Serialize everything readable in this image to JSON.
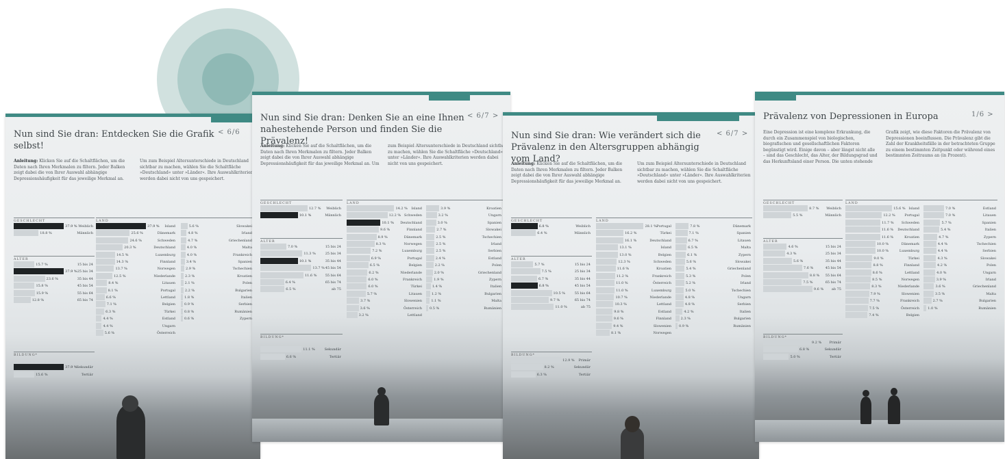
{
  "colors": {
    "accent": "#3f8a84",
    "bar": "#cfd4d7",
    "bar_selected": "#1e2224",
    "text": "#2f3437"
  },
  "instruction": {
    "label": "Anleitung:",
    "body": "Klicken Sie auf die Schaltflächen, um die Daten nach Ihren Merkmalen zu filtern. Jeder Balken zeigt dabei die von Ihrer Auswahl abhängige Depressionshäufigkeit für das jeweilige Merkmal an. Um zum Beispiel Altersunterschiede in Deutschland sichtbar zu machen, wählen Sie die Schaltfläche »Deutschland« unter »Länder«. Ihre Auswahlkriterien werden dabei nicht von uns gespeichert."
  },
  "sections": {
    "gender": "GESCHLECHT",
    "country": "LAND",
    "age": "ALTER",
    "education": "BILDUNG*"
  },
  "cards": [
    {
      "title": "Nun sind Sie dran: Entdecken Sie die Grafik selbst!",
      "nav": "< 6/6",
      "gender": [
        {
          "pct": "37.9 %",
          "label": "Weiblich"
        },
        {
          "pct": "18.8 %",
          "label": "Männlich"
        }
      ],
      "age": [
        {
          "pct": "15.7 %",
          "label": "15 bis 24"
        },
        {
          "pct": "37.9 %",
          "label": "25 bis 34"
        },
        {
          "pct": "23.6 %",
          "label": "35 bis 44"
        },
        {
          "pct": "15.8 %",
          "label": "45 bis 54"
        },
        {
          "pct": "15.9 %",
          "label": "55 bis 64"
        },
        {
          "pct": "12.8 %",
          "label": "65 bis 74"
        }
      ],
      "education": [
        {
          "pct": "37.9 %",
          "label": "Sekundär"
        },
        {
          "pct": "15.6 %",
          "label": "Tertiär"
        }
      ],
      "country1": [
        {
          "pct": "37.9 %",
          "label": "Island"
        },
        {
          "pct": "25.6 %",
          "label": "Dänemark"
        },
        {
          "pct": "24.6 %",
          "label": "Schweden"
        },
        {
          "pct": "20.3 %",
          "label": "Deutschland"
        },
        {
          "pct": "14.5 %",
          "label": "Luxemburg"
        },
        {
          "pct": "14.3 %",
          "label": "Finnland"
        },
        {
          "pct": "13.7 %",
          "label": "Norwegen"
        },
        {
          "pct": "12.5 %",
          "label": "Niederlande"
        },
        {
          "pct": "8.4 %",
          "label": "Litauen"
        },
        {
          "pct": "8.1 %",
          "label": "Portugal"
        },
        {
          "pct": "6.6 %",
          "label": "Lettland"
        },
        {
          "pct": "7.1 %",
          "label": "Belgien"
        },
        {
          "pct": "6.3 %",
          "label": "Türkei"
        },
        {
          "pct": "4.4 %",
          "label": "Estland"
        },
        {
          "pct": "4.4 %",
          "label": "Ungarn"
        },
        {
          "pct": "5.6 %",
          "label": "Österreich"
        }
      ],
      "country2": [
        {
          "pct": "5.6 %",
          "label": "Slowakei"
        },
        {
          "pct": "4.8 %",
          "label": "Irland"
        },
        {
          "pct": "4.7 %",
          "label": "Griechenland"
        },
        {
          "pct": "4.0 %",
          "label": "Malta"
        },
        {
          "pct": "4.0 %",
          "label": "Frankreich"
        },
        {
          "pct": "3.4 %",
          "label": "Spanien"
        },
        {
          "pct": "2.9 %",
          "label": "Tschechien"
        },
        {
          "pct": "2.3 %",
          "label": "Kroatien"
        },
        {
          "pct": "2.1 %",
          "label": "Polen"
        },
        {
          "pct": "2.2 %",
          "label": "Bulgarien"
        },
        {
          "pct": "1.8 %",
          "label": "Italien"
        },
        {
          "pct": "0.9 %",
          "label": "Serbien"
        },
        {
          "pct": "0.8 %",
          "label": "Rumänien"
        },
        {
          "pct": "0.6 %",
          "label": "Zypern"
        }
      ]
    },
    {
      "title": "Nun sind Sie dran: Denken Sie an eine Ihnen nahestehende Person und finden Sie die Prävalenz!",
      "nav": "< 6/7 >",
      "gender": [
        {
          "pct": "12.7 %",
          "label": "Weiblich"
        },
        {
          "pct": "10.1 %",
          "label": "Männlich"
        }
      ],
      "age": [
        {
          "pct": "7.0 %",
          "label": "15 bis 24"
        },
        {
          "pct": "11.3 %",
          "label": "25 bis 34"
        },
        {
          "pct": "10.1 %",
          "label": "35 bis 44"
        },
        {
          "pct": "13.7 %",
          "label": "45 bis 54"
        },
        {
          "pct": "11.6 %",
          "label": "55 bis 64"
        },
        {
          "pct": "6.4 %",
          "label": "65 bis 74"
        },
        {
          "pct": "6.5 %",
          "label": "ab 75"
        }
      ],
      "education": [
        {
          "pct": "11.1 %",
          "label": "Sekundär"
        },
        {
          "pct": "6.6 %",
          "label": "Tertiär"
        }
      ],
      "country1": [
        {
          "pct": "14.2 %",
          "label": "Island"
        },
        {
          "pct": "12.2 %",
          "label": "Schweden"
        },
        {
          "pct": "10.1 %",
          "label": "Deutschland"
        },
        {
          "pct": "9.6 %",
          "label": "Finnland"
        },
        {
          "pct": "8.9 %",
          "label": "Dänemark"
        },
        {
          "pct": "8.3 %",
          "label": "Norwegen"
        },
        {
          "pct": "7.2 %",
          "label": "Luxemburg"
        },
        {
          "pct": "6.9 %",
          "label": "Portugal"
        },
        {
          "pct": "6.5 %",
          "label": "Belgien"
        },
        {
          "pct": "6.2 %",
          "label": "Niederlande"
        },
        {
          "pct": "6.0 %",
          "label": "Frankreich"
        },
        {
          "pct": "6.0 %",
          "label": "Türkei"
        },
        {
          "pct": "5.7 %",
          "label": "Litauen"
        },
        {
          "pct": "3.7 %",
          "label": "Slowenien"
        },
        {
          "pct": "3.6 %",
          "label": "Österreich"
        },
        {
          "pct": "3.2 %",
          "label": "Lettland"
        }
      ],
      "country2": [
        {
          "pct": "3.9 %",
          "label": "Kroatien"
        },
        {
          "pct": "3.2 %",
          "label": "Ungarn"
        },
        {
          "pct": "3.0 %",
          "label": "Spanien"
        },
        {
          "pct": "2.7 %",
          "label": "Slowakei"
        },
        {
          "pct": "2.5 %",
          "label": "Tschechien"
        },
        {
          "pct": "2.5 %",
          "label": "Irland"
        },
        {
          "pct": "2.5 %",
          "label": "Serbien"
        },
        {
          "pct": "2.4 %",
          "label": "Estland"
        },
        {
          "pct": "2.2 %",
          "label": "Polen"
        },
        {
          "pct": "2.0 %",
          "label": "Griechenland"
        },
        {
          "pct": "1.9 %",
          "label": "Zypern"
        },
        {
          "pct": "1.4 %",
          "label": "Italien"
        },
        {
          "pct": "1.2 %",
          "label": "Bulgarien"
        },
        {
          "pct": "1.1 %",
          "label": "Malta"
        },
        {
          "pct": "0.5 %",
          "label": "Rumänien"
        }
      ]
    },
    {
      "title": "Nun sind Sie dran: Wie verändert sich die Prävalenz in den Altersgruppen abhängig vom Land?",
      "nav": "< 6/7 >",
      "gender": [
        {
          "pct": "6.8 %",
          "label": "Weiblich"
        },
        {
          "pct": "6.4 %",
          "label": "Männlich"
        }
      ],
      "age": [
        {
          "pct": "5.7 %",
          "label": "15 bis 24"
        },
        {
          "pct": "7.5 %",
          "label": "25 bis 34"
        },
        {
          "pct": "6.7 %",
          "label": "35 bis 44"
        },
        {
          "pct": "6.8 %",
          "label": "45 bis 54"
        },
        {
          "pct": "10.5 %",
          "label": "55 bis 64"
        },
        {
          "pct": "9.7 %",
          "label": "65 bis 74"
        },
        {
          "pct": "11.0 %",
          "label": "ab 75"
        }
      ],
      "education": [
        {
          "pct": "12.9 %",
          "label": "Primär"
        },
        {
          "pct": "8.2 %",
          "label": "Sekundär"
        },
        {
          "pct": "6.3 %",
          "label": "Tertiär"
        }
      ],
      "country1": [
        {
          "pct": "28.1 %",
          "label": "Portugal"
        },
        {
          "pct": "16.2 %",
          "label": "Türkei"
        },
        {
          "pct": "16.1 %",
          "label": "Deutschland"
        },
        {
          "pct": "13.1 %",
          "label": "Island"
        },
        {
          "pct": "13.0 %",
          "label": "Belgien"
        },
        {
          "pct": "12.3 %",
          "label": "Schweden"
        },
        {
          "pct": "11.6 %",
          "label": "Kroatien"
        },
        {
          "pct": "11.2 %",
          "label": "Frankreich"
        },
        {
          "pct": "11.0 %",
          "label": "Österreich"
        },
        {
          "pct": "11.0 %",
          "label": "Luxemburg"
        },
        {
          "pct": "10.7 %",
          "label": "Niederlande"
        },
        {
          "pct": "10.3 %",
          "label": "Lettland"
        },
        {
          "pct": "9.8 %",
          "label": "Estland"
        },
        {
          "pct": "9.6 %",
          "label": "Finnland"
        },
        {
          "pct": "9.4 %",
          "label": "Slowenien"
        },
        {
          "pct": "8.1 %",
          "label": "Norwegen"
        }
      ],
      "country2": [
        {
          "pct": "7.8 %",
          "label": "Dänemark"
        },
        {
          "pct": "7.1 %",
          "label": "Spanien"
        },
        {
          "pct": "6.7 %",
          "label": "Litauen"
        },
        {
          "pct": "6.5 %",
          "label": "Malta"
        },
        {
          "pct": "6.1 %",
          "label": "Zypern"
        },
        {
          "pct": "5.6 %",
          "label": "Slowakei"
        },
        {
          "pct": "5.4 %",
          "label": "Griechenland"
        },
        {
          "pct": "5.3 %",
          "label": "Polen"
        },
        {
          "pct": "5.2 %",
          "label": "Irland"
        },
        {
          "pct": "5.0 %",
          "label": "Tschechien"
        },
        {
          "pct": "4.8 %",
          "label": "Ungarn"
        },
        {
          "pct": "4.8 %",
          "label": "Serbien"
        },
        {
          "pct": "4.2 %",
          "label": "Italien"
        },
        {
          "pct": "2.3 %",
          "label": "Bulgarien"
        },
        {
          "pct": "0.9 %",
          "label": "Rumänien"
        }
      ]
    },
    {
      "title": "Prävalenz von Depressionen in Europa",
      "nav": "1/6 >",
      "intro": "Eine Depression ist eine komplexe Erkrankung, die durch ein Zusammenspiel von biologischen, biografischen und gesellschaftlichen Faktoren begünstigt wird. Einige davon – aber längst nicht alle – sind das Geschlecht, das Alter, der Bildungsgrad und das Herkunftsland einer Person. Die unten stehende Grafik zeigt, wie diese Faktoren die Prävalenz von Depressionen beeinflussen. Die Prävalenz gibt die Zahl der Krankheitsfälle in der betrachteten Gruppe zu einem bestimmten Zeitpunkt oder während eines bestimmten Zeitraums an (in Prozent).",
      "gender": [
        {
          "pct": "8.7 %",
          "label": "Weiblich"
        },
        {
          "pct": "5.5 %",
          "label": "Männlich"
        }
      ],
      "age": [
        {
          "pct": "4.6 %",
          "label": "15 bis 24"
        },
        {
          "pct": "4.3 %",
          "label": "25 bis 34"
        },
        {
          "pct": "5.6 %",
          "label": "35 bis 44"
        },
        {
          "pct": "7.6 %",
          "label": "45 bis 54"
        },
        {
          "pct": "8.8 %",
          "label": "55 bis 64"
        },
        {
          "pct": "7.5 %",
          "label": "65 bis 74"
        },
        {
          "pct": "9.6 %",
          "label": "ab 75"
        }
      ],
      "education": [
        {
          "pct": "9.2 %",
          "label": "Primär"
        },
        {
          "pct": "6.8 %",
          "label": "Sekundär"
        },
        {
          "pct": "5.0 %",
          "label": "Tertiär"
        }
      ],
      "country1": [
        {
          "pct": "15.6 %",
          "label": "Island"
        },
        {
          "pct": "12.2 %",
          "label": "Portugal"
        },
        {
          "pct": "11.7 %",
          "label": "Schweden"
        },
        {
          "pct": "11.6 %",
          "label": "Deutschland"
        },
        {
          "pct": "11.6 %",
          "label": "Kroatien"
        },
        {
          "pct": "10.0 %",
          "label": "Dänemark"
        },
        {
          "pct": "10.0 %",
          "label": "Luxemburg"
        },
        {
          "pct": "9.0 %",
          "label": "Türkei"
        },
        {
          "pct": "8.8 %",
          "label": "Finnland"
        },
        {
          "pct": "8.6 %",
          "label": "Lettland"
        },
        {
          "pct": "8.5 %",
          "label": "Norwegen"
        },
        {
          "pct": "8.3 %",
          "label": "Niederlande"
        },
        {
          "pct": "7.9 %",
          "label": "Slowenien"
        },
        {
          "pct": "7.7 %",
          "label": "Frankreich"
        },
        {
          "pct": "7.5 %",
          "label": "Österreich"
        },
        {
          "pct": "7.4 %",
          "label": "Belgien"
        }
      ],
      "country2": [
        {
          "pct": "7.0 %",
          "label": "Estland"
        },
        {
          "pct": "7.0 %",
          "label": "Litauen"
        },
        {
          "pct": "5.7 %",
          "label": "Spanien"
        },
        {
          "pct": "5.4 %",
          "label": "Italien"
        },
        {
          "pct": "4.7 %",
          "label": "Zypern"
        },
        {
          "pct": "4.4 %",
          "label": "Tschechien"
        },
        {
          "pct": "4.4 %",
          "label": "Serbien"
        },
        {
          "pct": "4.3 %",
          "label": "Slowakei"
        },
        {
          "pct": "4.2 %",
          "label": "Polen"
        },
        {
          "pct": "4.0 %",
          "label": "Ungarn"
        },
        {
          "pct": "3.9 %",
          "label": "Irland"
        },
        {
          "pct": "3.6 %",
          "label": "Griechenland"
        },
        {
          "pct": "3.5 %",
          "label": "Malta"
        },
        {
          "pct": "2.7 %",
          "label": "Bulgarien"
        },
        {
          "pct": "1.0 %",
          "label": "Rumänien"
        }
      ]
    }
  ]
}
